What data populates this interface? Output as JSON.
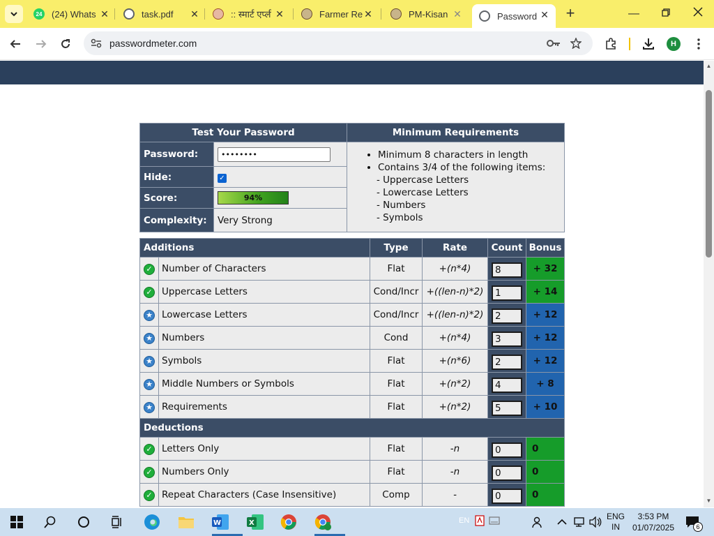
{
  "browser": {
    "tabs": [
      {
        "label": "(24) Whats",
        "icon": "whatsapp-icon",
        "badge": "24",
        "color": "#25d366"
      },
      {
        "label": "task.pdf",
        "icon": "globe-icon",
        "color": "#5f6368"
      },
      {
        "label": ":: स्मार्ट एप्ली",
        "icon": "emblem-icon",
        "color": "#a0522d"
      },
      {
        "label": "Farmer Re",
        "icon": "emblem-icon",
        "color": "#6b4e2e"
      },
      {
        "label": "PM-Kisan",
        "icon": "emblem-icon",
        "color": "#6b4e2e"
      },
      {
        "label": "Password",
        "icon": "globe-icon",
        "color": "#5f6368",
        "active": true
      }
    ],
    "url": "passwordmeter.com",
    "profile_initial": "H",
    "accent": "#f9ee6b"
  },
  "summary": {
    "header_left": "Test Your Password",
    "header_right": "Minimum Requirements",
    "password_label": "Password:",
    "password_value": "••••••••",
    "hide_label": "Hide:",
    "score_label": "Score:",
    "score_value": "94%",
    "score_fraction": 0.94,
    "complexity_label": "Complexity:",
    "complexity_value": "Very Strong",
    "requirements": {
      "item1": "Minimum 8 characters in length",
      "item2": "Contains 3/4 of the following items:",
      "sub": [
        "- Uppercase Letters",
        "- Lowercase Letters",
        "- Numbers",
        "- Symbols"
      ]
    }
  },
  "scoring": {
    "headers": {
      "additions": "Additions",
      "type": "Type",
      "rate": "Rate",
      "count": "Count",
      "bonus": "Bonus"
    },
    "additions": [
      {
        "name": "Number of Characters",
        "type": "Flat",
        "rate": "+(n*4)",
        "count": "8",
        "bonus": "+ 32",
        "status": "ok",
        "bonus_color": "green"
      },
      {
        "name": "Uppercase Letters",
        "type": "Cond/Incr",
        "rate": "+((len-n)*2)",
        "count": "1",
        "bonus": "+ 14",
        "status": "ok",
        "bonus_color": "green"
      },
      {
        "name": "Lowercase Letters",
        "type": "Cond/Incr",
        "rate": "+((len-n)*2)",
        "count": "2",
        "bonus": "+ 12",
        "status": "star",
        "bonus_color": "blue"
      },
      {
        "name": "Numbers",
        "type": "Cond",
        "rate": "+(n*4)",
        "count": "3",
        "bonus": "+ 12",
        "status": "star",
        "bonus_color": "blue"
      },
      {
        "name": "Symbols",
        "type": "Flat",
        "rate": "+(n*6)",
        "count": "2",
        "bonus": "+ 12",
        "status": "star",
        "bonus_color": "blue"
      },
      {
        "name": "Middle Numbers or Symbols",
        "type": "Flat",
        "rate": "+(n*2)",
        "count": "4",
        "bonus": "+ 8",
        "status": "star",
        "bonus_color": "blue"
      },
      {
        "name": "Requirements",
        "type": "Flat",
        "rate": "+(n*2)",
        "count": "5",
        "bonus": "+ 10",
        "status": "star",
        "bonus_color": "blue"
      }
    ],
    "deductions_label": "Deductions",
    "deductions": [
      {
        "name": "Letters Only",
        "type": "Flat",
        "rate": "-n",
        "count": "0",
        "bonus": "0",
        "status": "ok",
        "bonus_color": "green"
      },
      {
        "name": "Numbers Only",
        "type": "Flat",
        "rate": "-n",
        "count": "0",
        "bonus": "0",
        "status": "ok",
        "bonus_color": "green"
      },
      {
        "name": "Repeat Characters (Case Insensitive)",
        "type": "Comp",
        "rate": "-",
        "count": "0",
        "bonus": "0",
        "status": "ok",
        "bonus_color": "green"
      }
    ]
  },
  "taskbar": {
    "lang_top": "ENG",
    "lang_bottom": "IN",
    "time": "3:53 PM",
    "date": "01/07/2025",
    "notifications": "6",
    "ime_hint": "EN"
  }
}
